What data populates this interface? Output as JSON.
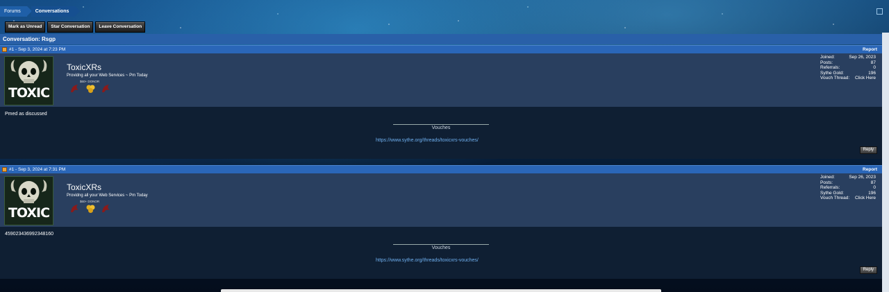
{
  "breadcrumb": {
    "forums": "Forums",
    "conversations": "Conversations"
  },
  "actions": {
    "mark_unread": "Mark as Unread",
    "star": "Star Conversation",
    "leave": "Leave Conversation"
  },
  "conversation": {
    "title": "Conversation: Rsgp"
  },
  "colors": {
    "header_blue": "#2a66b8",
    "author_bg": "#293f5f",
    "body_bg": "#0f1f33",
    "link": "#6fb0f0"
  },
  "posts": [
    {
      "meta": "#1 - Sep 3, 2024 at 7:23 PM",
      "report": "Report",
      "avatar_text": "TOXIC",
      "username": "ToxicXRs",
      "user_title": "Providng all your Web Services ~ Pm Today",
      "badge_label": "$60+ DONOR",
      "stats": [
        {
          "label": "Joined:",
          "value": "Sep 26, 2023"
        },
        {
          "label": "Posts:",
          "value": "87"
        },
        {
          "label": "Referrals:",
          "value": "0"
        },
        {
          "label": "Sythe Gold:",
          "value": "196"
        },
        {
          "label": "Vouch Thread:",
          "value": "Click Here"
        }
      ],
      "message": "Pmed as discussed",
      "sig_title": "Vouches",
      "sig_link": "https://www.sythe.org/threads/toxicxrs-vouches/",
      "reply": "Reply"
    },
    {
      "meta": "#1 - Sep 3, 2024 at 7:31 PM",
      "report": "Report",
      "avatar_text": "TOXIC",
      "username": "ToxicXRs",
      "user_title": "Providng all your Web Services ~ Pm Today",
      "badge_label": "$60+ DONOR",
      "stats": [
        {
          "label": "Joined:",
          "value": "Sep 26, 2023"
        },
        {
          "label": "Posts:",
          "value": "87"
        },
        {
          "label": "Referrals:",
          "value": "0"
        },
        {
          "label": "Sythe Gold:",
          "value": "196"
        },
        {
          "label": "Vouch Thread:",
          "value": "Click Here"
        }
      ],
      "message": "459023436992348160",
      "sig_title": "Vouches",
      "sig_link": "https://www.sythe.org/threads/toxicxrs-vouches/",
      "reply": "Reply"
    }
  ]
}
